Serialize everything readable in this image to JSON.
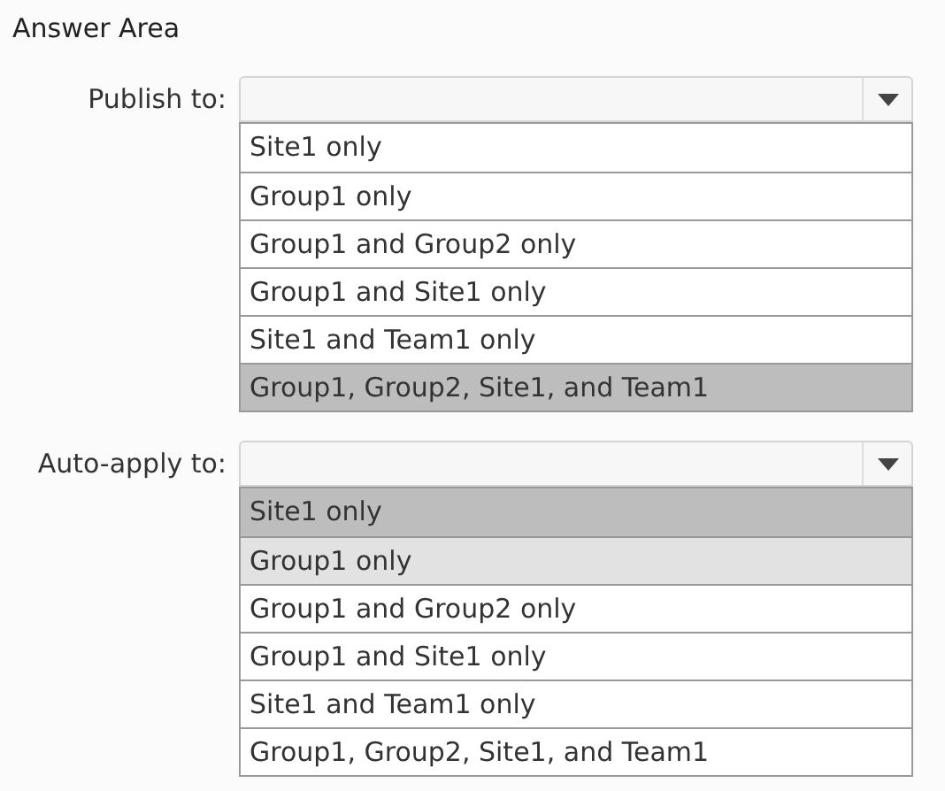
{
  "title": "Answer Area",
  "dropdowns": [
    {
      "label": "Publish to:",
      "options": [
        {
          "text": "Site1 only",
          "selected": false,
          "hovered": false
        },
        {
          "text": "Group1 only",
          "selected": false,
          "hovered": false
        },
        {
          "text": "Group1 and Group2 only",
          "selected": false,
          "hovered": false
        },
        {
          "text": "Group1 and Site1 only",
          "selected": false,
          "hovered": false
        },
        {
          "text": "Site1 and Team1 only",
          "selected": false,
          "hovered": false
        },
        {
          "text": "Group1, Group2, Site1, and Team1",
          "selected": true,
          "hovered": false
        }
      ]
    },
    {
      "label": "Auto-apply to:",
      "options": [
        {
          "text": "Site1 only",
          "selected": true,
          "hovered": false
        },
        {
          "text": "Group1 only",
          "selected": false,
          "hovered": true
        },
        {
          "text": "Group1 and Group2 only",
          "selected": false,
          "hovered": false
        },
        {
          "text": "Group1 and Site1 only",
          "selected": false,
          "hovered": false
        },
        {
          "text": "Site1 and Team1 only",
          "selected": false,
          "hovered": false
        },
        {
          "text": "Group1, Group2, Site1, and Team1",
          "selected": false,
          "hovered": false
        }
      ]
    }
  ]
}
